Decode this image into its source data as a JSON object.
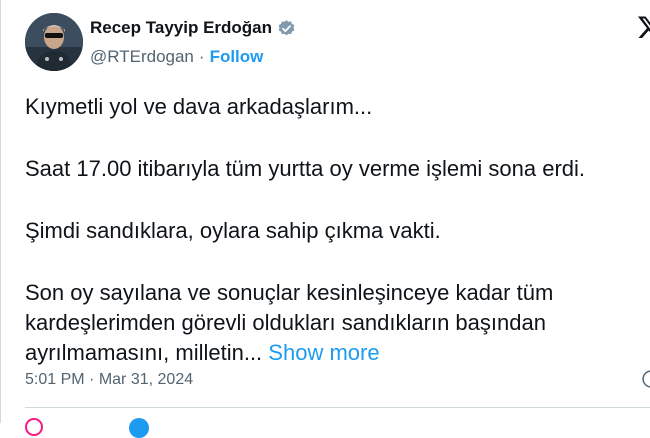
{
  "author": {
    "display_name": "Recep Tayyip Erdoğan",
    "handle": "@RTErdogan",
    "separator": "·",
    "follow_label": "Follow",
    "verified_color": "#829aab"
  },
  "tweet": {
    "paragraphs": [
      "Kıymetli yol ve dava arkadaşlarım...",
      "Saat 17.00 itibarıyla tüm yurtta oy verme işlemi sona erdi.",
      "Şimdi sandıklara, oylara sahip çıkma vakti."
    ],
    "last_paragraph_lines": [
      "Son oy sayılana ve sonuçlar kesinleşinceye kadar tüm",
      "kardeşlerimden görevli oldukları sandıkların başından",
      "ayrılmamasını, milletin..."
    ],
    "show_more_label": "Show more"
  },
  "meta": {
    "time": "5:01 PM",
    "separator": "·",
    "date": "Mar 31, 2024"
  },
  "colors": {
    "accent": "#1d9bf0",
    "text": "#0f1419",
    "secondary": "#536471",
    "border": "#cfd9de"
  },
  "icons": {
    "verified": "verified-badge-icon",
    "platform": "x-logo-icon",
    "info": "info-icon"
  }
}
